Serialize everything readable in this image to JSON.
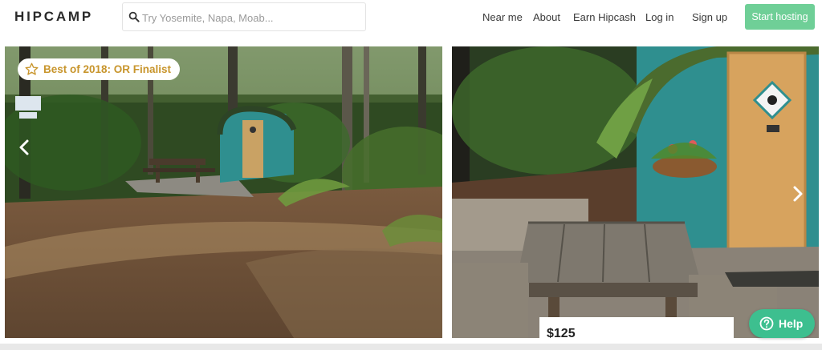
{
  "header": {
    "logo": "HIPCAMP",
    "search_placeholder": "Try Yosemite, Napa, Moab...",
    "search_icon": "search-icon",
    "nav": [
      "Near me",
      "About",
      "Earn Hipcash",
      "Log in",
      "Sign up"
    ],
    "cta_label": "Start hosting"
  },
  "gallery": {
    "badge_icon": "star-icon",
    "badge_text": "Best of 2018: OR Finalist",
    "prev_icon": "chevron-left-icon",
    "next_icon": "chevron-right-icon"
  },
  "listing": {
    "price": "$125"
  },
  "help": {
    "icon": "question-circle-icon",
    "label": "Help"
  },
  "colors": {
    "accent": "#6fcf97",
    "help": "#3dbf8f",
    "badge_text": "#c8952c",
    "cabin_teal": "#2f8f8f"
  }
}
